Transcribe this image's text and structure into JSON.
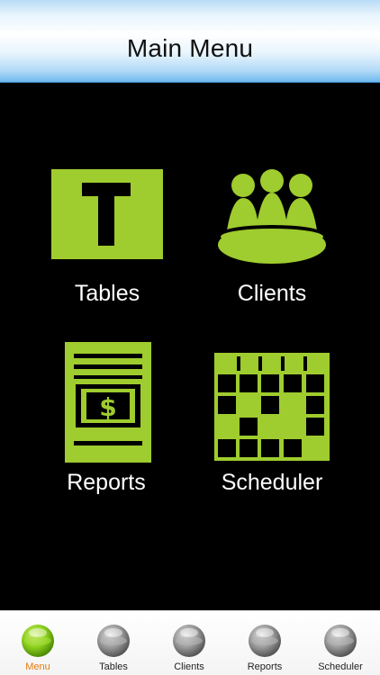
{
  "header": {
    "title": "Main Menu"
  },
  "menu": {
    "tiles": [
      {
        "label": "Tables",
        "icon": "table-icon"
      },
      {
        "label": "Clients",
        "icon": "clients-icon"
      },
      {
        "label": "Reports",
        "icon": "report-icon"
      },
      {
        "label": "Scheduler",
        "icon": "calendar-icon"
      }
    ]
  },
  "tabs": [
    {
      "label": "Menu",
      "active": true
    },
    {
      "label": "Tables",
      "active": false
    },
    {
      "label": "Clients",
      "active": false
    },
    {
      "label": "Reports",
      "active": false
    },
    {
      "label": "Scheduler",
      "active": false
    }
  ],
  "colors": {
    "accent": "#9fcc2e",
    "header_blue": "#6fb8ee",
    "active_tab": "#e07a10",
    "tab_ball_green": "#8ccf1c",
    "tab_ball_gray": "#9a9a9a"
  }
}
